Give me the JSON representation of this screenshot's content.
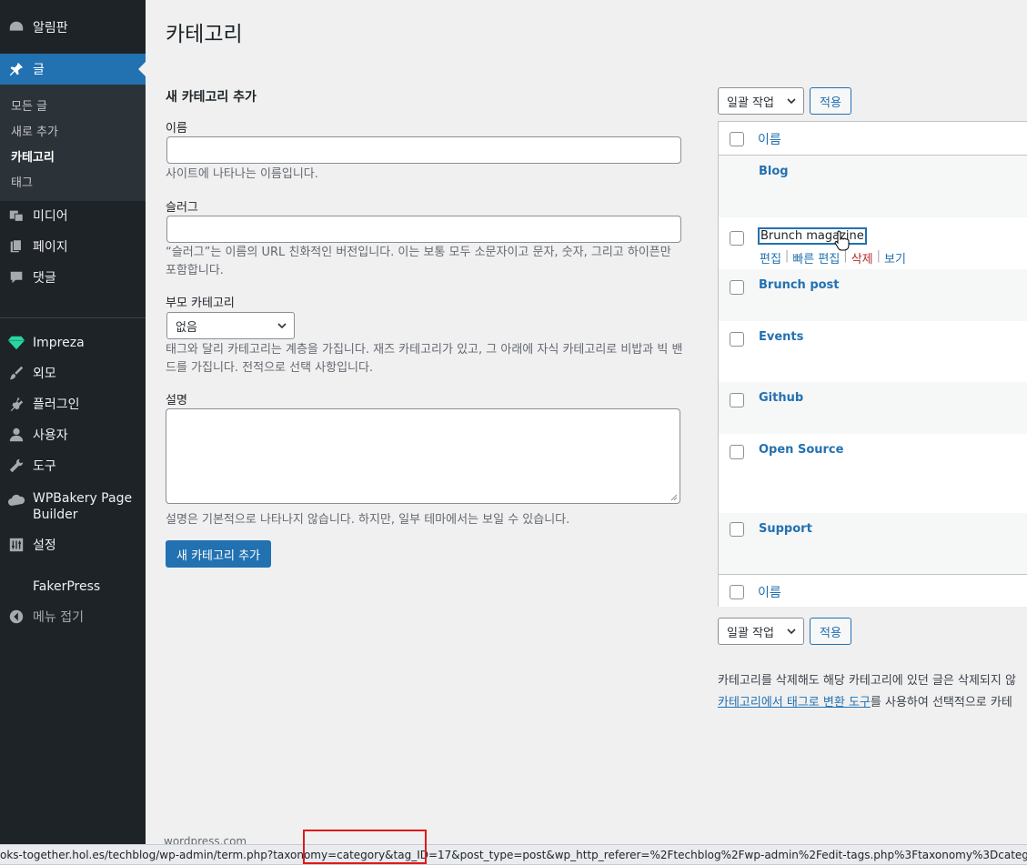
{
  "sidebar": {
    "items": [
      {
        "label": "알림판",
        "icon": "dashboard-icon"
      },
      {
        "label": "글",
        "icon": "pin-icon"
      },
      {
        "label": "미디어",
        "icon": "media-icon"
      },
      {
        "label": "페이지",
        "icon": "page-icon"
      },
      {
        "label": "댓글",
        "icon": "comment-icon"
      },
      {
        "label": "Impreza",
        "icon": "diamond-icon"
      },
      {
        "label": "외모",
        "icon": "brush-icon"
      },
      {
        "label": "플러그인",
        "icon": "plugin-icon"
      },
      {
        "label": "사용자",
        "icon": "user-icon"
      },
      {
        "label": "도구",
        "icon": "wrench-icon"
      },
      {
        "label": "WPBakery Page Builder",
        "icon": "cloud-icon"
      },
      {
        "label": "설정",
        "icon": "settings-icon"
      },
      {
        "label": "FakerPress",
        "icon": ""
      },
      {
        "label": "메뉴 접기",
        "icon": "collapse-icon"
      }
    ],
    "submenu": [
      "모든 글",
      "새로 추가",
      "카테고리",
      "태그"
    ]
  },
  "main": {
    "page_title": "카테고리",
    "form": {
      "section_title": "새 카테고리 추가",
      "name_label": "이름",
      "name_help": "사이트에 나타나는 이름입니다.",
      "slug_label": "슬러그",
      "slug_help": "“슬러그”는 이름의 URL 친화적인 버전입니다. 이는 보통 모두 소문자이고 문자, 숫자, 그리고 하이픈만 포함합니다.",
      "parent_label": "부모 카테고리",
      "parent_value": "없음",
      "parent_help": "태그와 달리 카테고리는 계층을 가집니다. 재즈 카테고리가 있고, 그 아래에 자식 카테고리로 비밥과 빅 밴드를 가집니다. 전적으로 선택 사항입니다.",
      "desc_label": "설명",
      "desc_help": "설명은 기본적으로 나타나지 않습니다. 하지만, 일부 테마에서는 보일 수 있습니다.",
      "submit_label": "새 카테고리 추가"
    },
    "bulk": {
      "select_label": "일괄 작업",
      "apply_label": "적용"
    },
    "table": {
      "column_name": "이름",
      "rows": [
        {
          "name": "Blog"
        },
        {
          "name": "Brunch magazine"
        },
        {
          "name": "Brunch post"
        },
        {
          "name": "Events"
        },
        {
          "name": "Github"
        },
        {
          "name": "Open Source"
        },
        {
          "name": "Support"
        }
      ],
      "row_actions": {
        "edit": "편집",
        "quick_edit": "빠른 편집",
        "delete": "삭제",
        "view": "보기"
      }
    },
    "note_line1": "카테고리를 삭제해도 해당 카테고리에 있던 글은 삭제되지 않",
    "note_link": "카테고리에서 태그로 변환 도구",
    "note_line2_rest": "를 사용하여 선택적으로 카테"
  },
  "footer_ghost": "wordpress.com",
  "statusbar": "oks-together.hol.es/techblog/wp-admin/term.php?taxonomy=category&tag_ID=17&post_type=post&wp_http_referer=%2Ftechblog%2Fwp-admin%2Fedit-tags.php%3Ftaxonomy%3Dcategory",
  "colors": {
    "sidebar_bg": "#1d2327",
    "accent": "#2271b1",
    "delete": "#b32d2e",
    "highlight_box": "#e0191b"
  }
}
